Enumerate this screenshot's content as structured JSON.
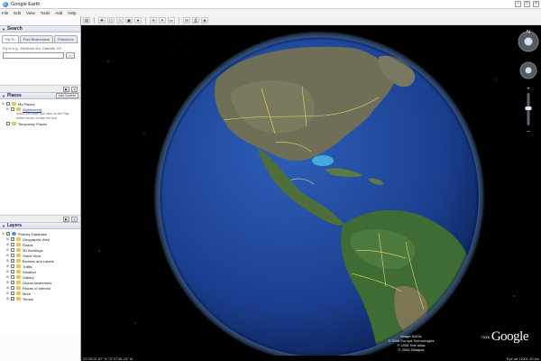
{
  "window": {
    "title": "Google Earth",
    "minimize": "–",
    "maximize": "□",
    "close": "×"
  },
  "menu": [
    "File",
    "Edit",
    "View",
    "Tools",
    "Add",
    "Help"
  ],
  "search": {
    "header": "Search",
    "tabs": [
      "Fly To",
      "Find Businesses",
      "Directions"
    ],
    "hint": "Fly to e.g., Hemlock Rd, Oakville, NY",
    "go": "›"
  },
  "places": {
    "header": "Places",
    "add_content": "Add Content",
    "items": [
      {
        "label": "My Places",
        "icon": "folder-icon",
        "indent": 0
      },
      {
        "label": "Sightseeing",
        "icon": "folder-icon",
        "indent": 1,
        "link": true
      },
      {
        "label": "Temporary Places",
        "icon": "folder-icon",
        "indent": 0
      }
    ],
    "note": "Select the folder and click on the Play button below, to start the tour"
  },
  "layers": {
    "header": "Layers",
    "items": [
      {
        "label": "Primary Database",
        "checked": true,
        "indent": 0,
        "icon": "globe-icon"
      },
      {
        "label": "Geographic Web",
        "checked": true,
        "indent": 1,
        "icon": "folder-icon"
      },
      {
        "label": "Roads",
        "checked": false,
        "indent": 1,
        "icon": "folder-icon"
      },
      {
        "label": "3D Buildings",
        "checked": false,
        "indent": 1,
        "icon": "folder-icon"
      },
      {
        "label": "Street View",
        "checked": false,
        "indent": 1,
        "icon": "folder-icon"
      },
      {
        "label": "Borders and Labels",
        "checked": true,
        "indent": 1,
        "icon": "folder-icon"
      },
      {
        "label": "Traffic",
        "checked": false,
        "indent": 1,
        "icon": "folder-icon"
      },
      {
        "label": "Weather",
        "checked": false,
        "indent": 1,
        "icon": "folder-icon"
      },
      {
        "label": "Gallery",
        "checked": false,
        "indent": 1,
        "icon": "folder-icon"
      },
      {
        "label": "Global Awareness",
        "checked": false,
        "indent": 1,
        "icon": "folder-icon"
      },
      {
        "label": "Places of Interest",
        "checked": false,
        "indent": 1,
        "icon": "folder-icon"
      },
      {
        "label": "More",
        "checked": false,
        "indent": 1,
        "icon": "folder-icon"
      },
      {
        "label": "Terrain",
        "checked": true,
        "indent": 1,
        "icon": "folder-icon"
      }
    ]
  },
  "viewport": {
    "copyright": [
      "Image NASA",
      "© 2008 Europa Technologies",
      "© 2008 Tele Atlas",
      "© 2008 DMapas"
    ],
    "logo": "Google",
    "logo_year": "©2008"
  },
  "status": {
    "coords": "23°28'31.87\" N    73°37'45.24\" W",
    "eye_alt": "Eye alt 11001.40 km"
  },
  "colors": {
    "ocean": "#1b3f8f",
    "border_lines": "#e5df6a",
    "land_green": "#3f6b34",
    "land_tan": "#8a8a6a"
  }
}
